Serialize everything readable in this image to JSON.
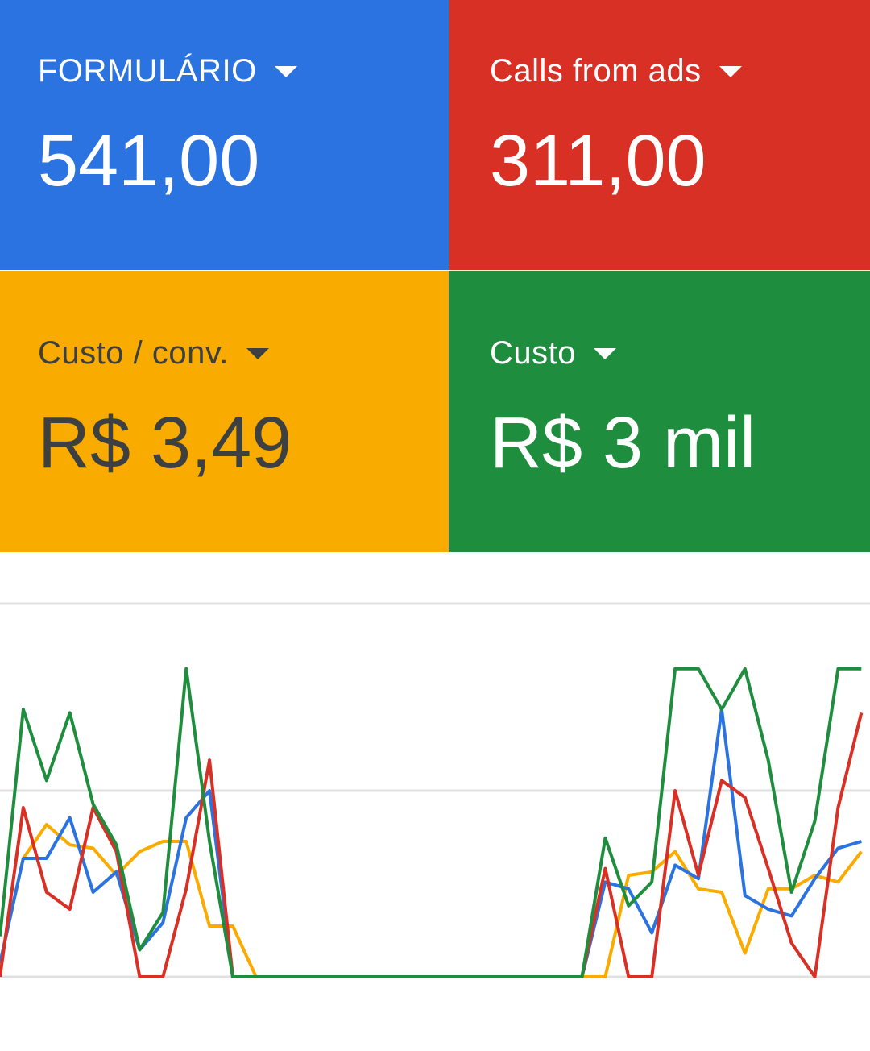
{
  "tiles": [
    {
      "label": "FORMULÁRIO",
      "value": "541,00",
      "bg": "#2a73e0",
      "fg": "#ffffff"
    },
    {
      "label": "Calls from ads",
      "value": "311,00",
      "bg": "#d93025",
      "fg": "#ffffff"
    },
    {
      "label": "Custo / conv.",
      "value": "R$ 3,49",
      "bg": "#f9ab00",
      "fg": "#3c4043"
    },
    {
      "label": "Custo",
      "value": "R$ 3 mil",
      "bg": "#1e8e3e",
      "fg": "#ffffff"
    }
  ],
  "chart_data": {
    "type": "line",
    "grid": true,
    "ylim": [
      0,
      100
    ],
    "x": [
      0,
      1,
      2,
      3,
      4,
      5,
      6,
      7,
      8,
      9,
      10,
      11,
      12,
      13,
      14,
      15,
      16,
      17,
      18,
      19,
      20,
      21,
      22,
      23,
      24,
      25,
      26,
      27,
      28,
      29,
      30,
      31,
      32,
      33,
      34,
      35,
      36,
      37
    ],
    "series": [
      {
        "color": "#1e8e3e",
        "values": [
          12,
          79,
          58,
          78,
          51,
          39,
          8,
          19,
          91,
          40,
          0,
          0,
          0,
          0,
          0,
          0,
          0,
          0,
          0,
          0,
          0,
          0,
          0,
          0,
          0,
          0,
          41,
          21,
          28,
          91,
          91,
          79,
          91,
          64,
          25,
          46,
          91,
          91
        ]
      },
      {
        "color": "#2a73e0",
        "values": [
          4,
          35,
          35,
          47,
          25,
          31,
          8,
          16,
          47,
          55,
          0,
          0,
          0,
          0,
          0,
          0,
          0,
          0,
          0,
          0,
          0,
          0,
          0,
          0,
          0,
          0,
          28,
          26,
          13,
          33,
          29,
          79,
          24,
          20,
          18,
          29,
          38,
          40
        ]
      },
      {
        "color": "#d93025",
        "values": [
          0,
          50,
          25,
          20,
          50,
          37,
          0,
          0,
          26,
          64,
          0,
          0,
          0,
          0,
          0,
          0,
          0,
          0,
          0,
          0,
          0,
          0,
          0,
          0,
          0,
          0,
          32,
          0,
          0,
          55,
          30,
          58,
          53,
          32,
          10,
          0,
          50,
          78
        ]
      },
      {
        "color": "#f9ab00",
        "values": [
          4,
          35,
          45,
          39,
          38,
          30,
          37,
          40,
          40,
          15,
          15,
          0,
          0,
          0,
          0,
          0,
          0,
          0,
          0,
          0,
          0,
          0,
          0,
          0,
          0,
          0,
          0,
          30,
          31,
          37,
          26,
          25,
          7,
          26,
          26,
          30,
          28,
          37
        ]
      }
    ]
  }
}
